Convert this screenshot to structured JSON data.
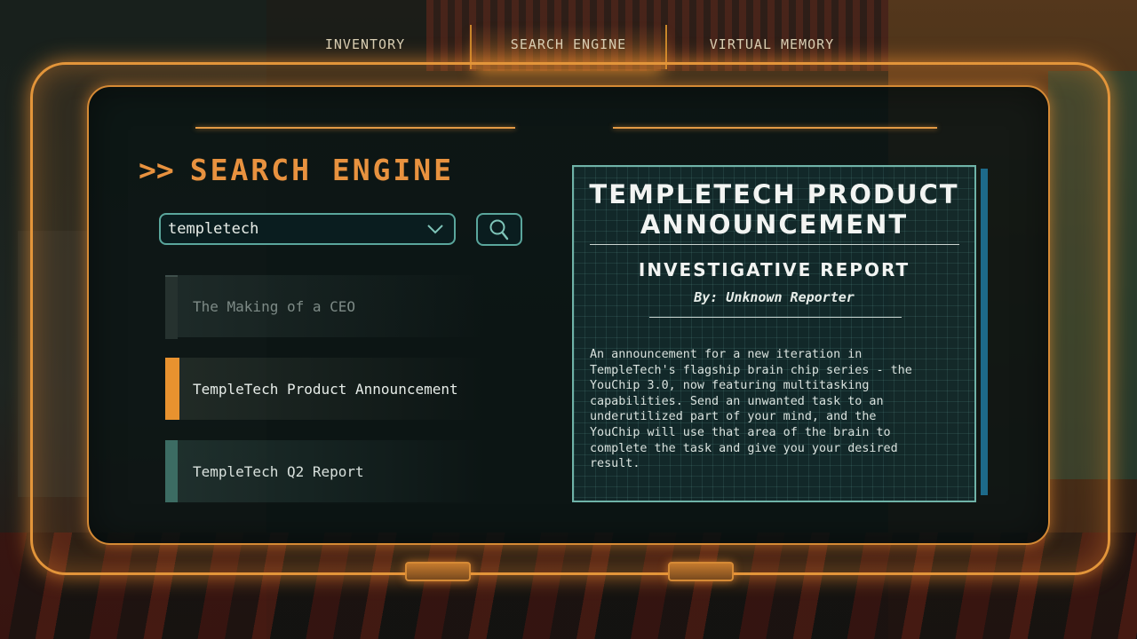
{
  "nav": {
    "tabs": [
      {
        "label": "INVENTORY",
        "active": false
      },
      {
        "label": "SEARCH ENGINE",
        "active": true
      },
      {
        "label": "VIRTUAL MEMORY",
        "active": false
      }
    ]
  },
  "page": {
    "chevron": ">>",
    "title": "SEARCH ENGINE"
  },
  "search": {
    "value": "templetech",
    "placeholder": ""
  },
  "results": [
    {
      "label": "The Making of a CEO",
      "state": "dimmed"
    },
    {
      "label": "TempleTech Product Announcement",
      "state": "selected"
    },
    {
      "label": "TempleTech Q2 Report",
      "state": "normal"
    }
  ],
  "article": {
    "title_line1": "TEMPLETECH PRODUCT",
    "title_line2": "ANNOUNCEMENT",
    "subtitle": "INVESTIGATIVE REPORT",
    "byline": "By: Unknown Reporter",
    "body": "An announcement for a new iteration in\nTempleTech's flagship brain chip series - the\nYouChip 3.0, now featuring multitasking\ncapabilities. Send an unwanted task to an\nunderutilized part of your mind, and the\nYouChip will use that area of the brain to\ncomplete the task and give you your desired\nresult."
  },
  "colors": {
    "accent_orange": "#e8923f",
    "accent_teal": "#6fb3a8",
    "scroll_blue": "#1d6a8a"
  },
  "icons": {
    "search": "magnifier-icon",
    "dropdown": "chevron-down-icon"
  }
}
